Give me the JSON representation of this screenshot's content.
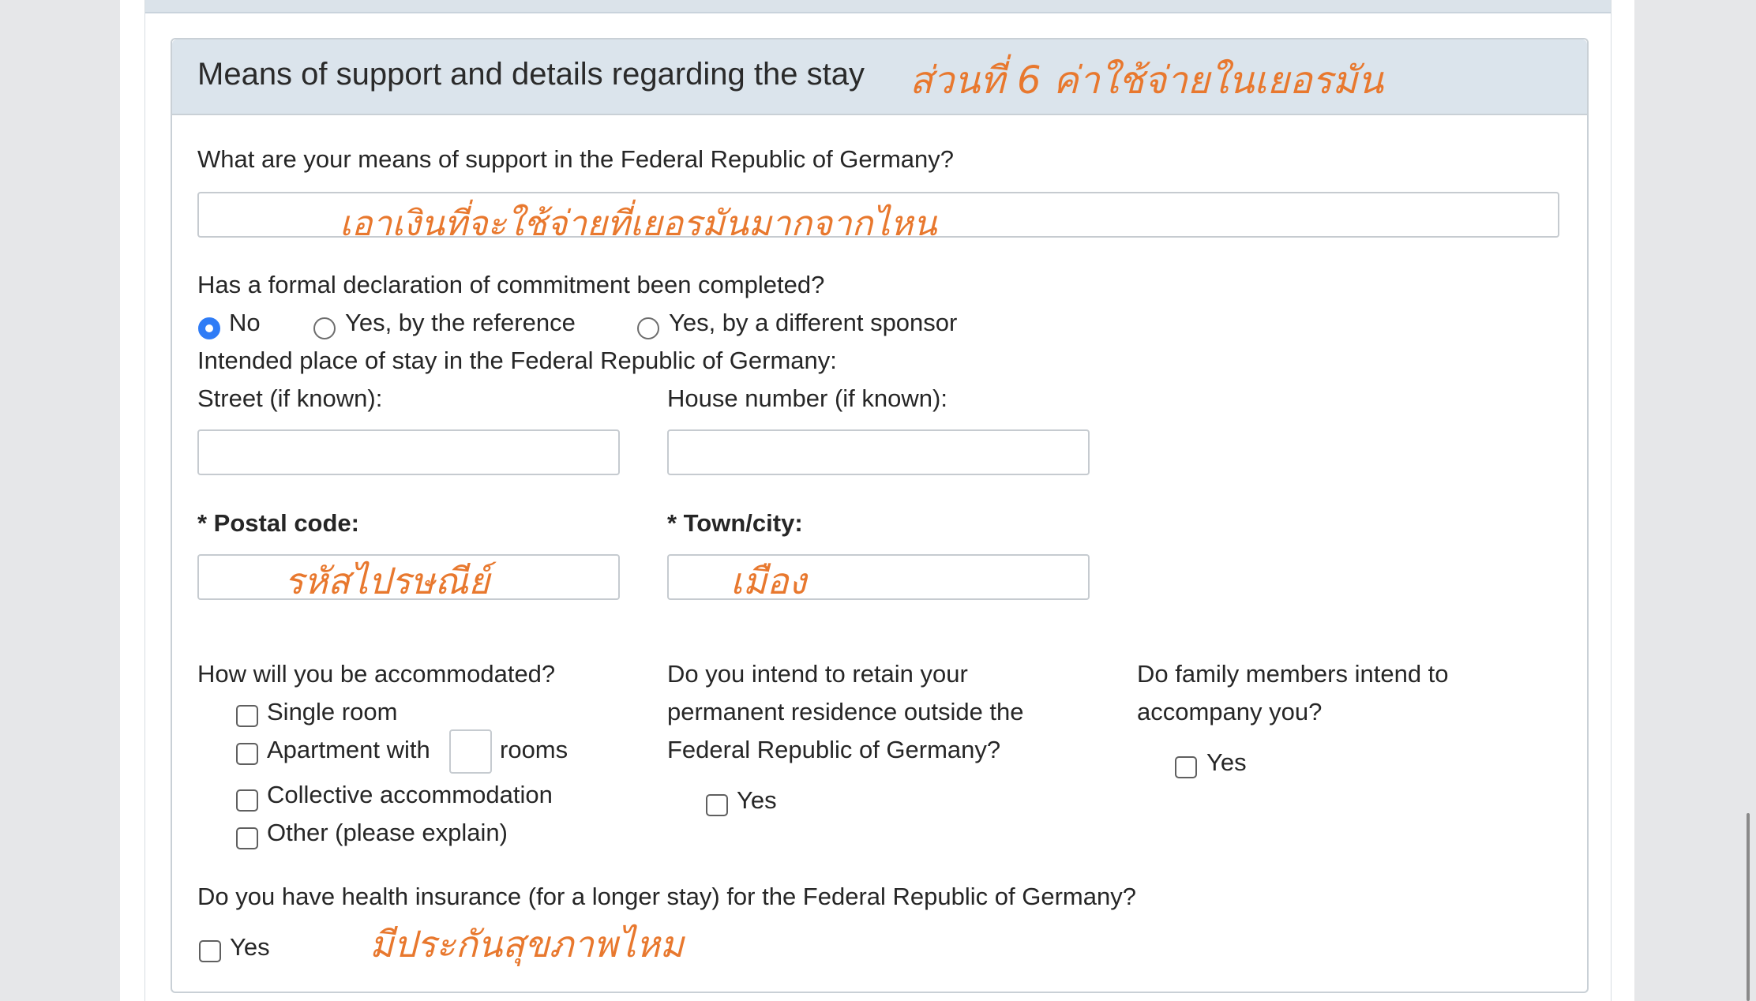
{
  "section": {
    "title": "Means of support and details regarding the stay",
    "handwriting_title": "ส่วนที่ 6 ค่าใช้จ่ายในเยอรมัน"
  },
  "support": {
    "question": "What are your means of support in the Federal Republic of Germany?",
    "value": "",
    "handwriting": "เอาเงินที่จะใช้จ่ายที่เยอรมันมากจากไหน"
  },
  "commitment": {
    "question": "Has a formal declaration of commitment been completed?",
    "options": [
      "No",
      "Yes, by the reference",
      "Yes, by a different sponsor"
    ],
    "selected": "No"
  },
  "stay": {
    "heading": "Intended place of stay in the Federal Republic of Germany:",
    "street_label": "Street (if known):",
    "street_value": "",
    "house_label": "House number (if known):",
    "house_value": "",
    "postal_label": "* Postal code:",
    "postal_value": "",
    "postal_handwriting": "รหัสไปรษณีย์",
    "town_label": "* Town/city:",
    "town_value": "",
    "town_handwriting": "เมือง"
  },
  "accommodation": {
    "question": "How will you be accommodated?",
    "single_room": "Single room",
    "apartment_prefix": "Apartment with",
    "apartment_rooms_value": "",
    "apartment_suffix": "rooms",
    "collective": "Collective accommodation",
    "other": "Other (please explain)"
  },
  "residence": {
    "question_line1": "Do you intend to retain your",
    "question_line2": "permanent residence outside the",
    "question_line3": "Federal Republic of Germany?",
    "yes_label": "Yes"
  },
  "family": {
    "question_line1": "Do family members intend to",
    "question_line2": "accompany you?",
    "yes_label": "Yes"
  },
  "insurance": {
    "question": "Do you have health insurance (for a longer stay) for the Federal Republic of Germany?",
    "yes_label": "Yes",
    "handwriting": "มีประกันสุขภาพไหม"
  },
  "colors": {
    "accent": "#2f7cf6",
    "handwriting": "#e8782e",
    "panel_header": "#dbe4ec"
  }
}
